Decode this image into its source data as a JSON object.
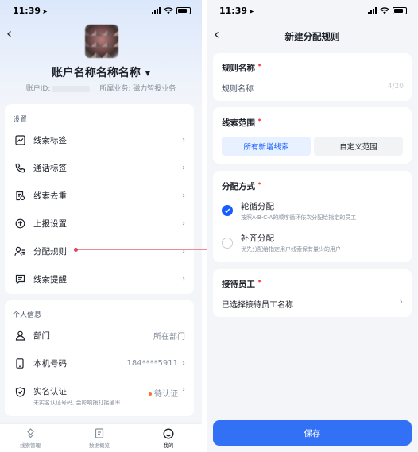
{
  "status": {
    "time": "11:39"
  },
  "profile": {
    "account_name": "账户名称名称名称",
    "account_id_label": "账户ID:",
    "business_label": "所属业务: 磁力智投业务"
  },
  "settings": {
    "title": "设置",
    "items": [
      {
        "label": "线索标签",
        "icon": "tag-icon"
      },
      {
        "label": "通话标签",
        "icon": "phone-icon"
      },
      {
        "label": "线索去重",
        "icon": "dedupe-icon"
      },
      {
        "label": "上报设置",
        "icon": "upload-icon"
      },
      {
        "label": "分配规则",
        "icon": "assign-user-icon"
      },
      {
        "label": "线索提醒",
        "icon": "message-icon"
      }
    ]
  },
  "personal": {
    "title": "个人信息",
    "department": {
      "label": "部门",
      "value": "所在部门"
    },
    "phone": {
      "label": "本机号码",
      "value": "184****5911"
    },
    "verify": {
      "label": "实名认证",
      "sub": "未实名认证号码, 会影响拨打接通率",
      "status": "待认证"
    }
  },
  "tabs": [
    {
      "label": "线索管理",
      "icon": "leads-icon"
    },
    {
      "label": "数据概览",
      "icon": "data-icon"
    },
    {
      "label": "我的",
      "icon": "smile-icon"
    }
  ],
  "rule_form": {
    "page_title": "新建分配规则",
    "name": {
      "label": "规则名称",
      "placeholder": "规则名称",
      "counter": "4/20"
    },
    "scope": {
      "label": "线索范围",
      "options": [
        "所有新增线索",
        "自定义范围"
      ],
      "selected": "所有新增线索"
    },
    "method": {
      "label": "分配方式",
      "options": [
        {
          "title": "轮循分配",
          "desc": "按照A-B-C-A的顺序循环依次分配给指定的员工",
          "selected": true
        },
        {
          "title": "补齐分配",
          "desc": "优先分配给指定用户线索保有量少的用户",
          "selected": false
        }
      ]
    },
    "staff": {
      "label": "接待员工",
      "value": "已选择接待员工名称"
    },
    "save_label": "保存"
  },
  "colors": {
    "accent": "#165dff",
    "button": "#3270f6",
    "required": "#f53f3f"
  }
}
